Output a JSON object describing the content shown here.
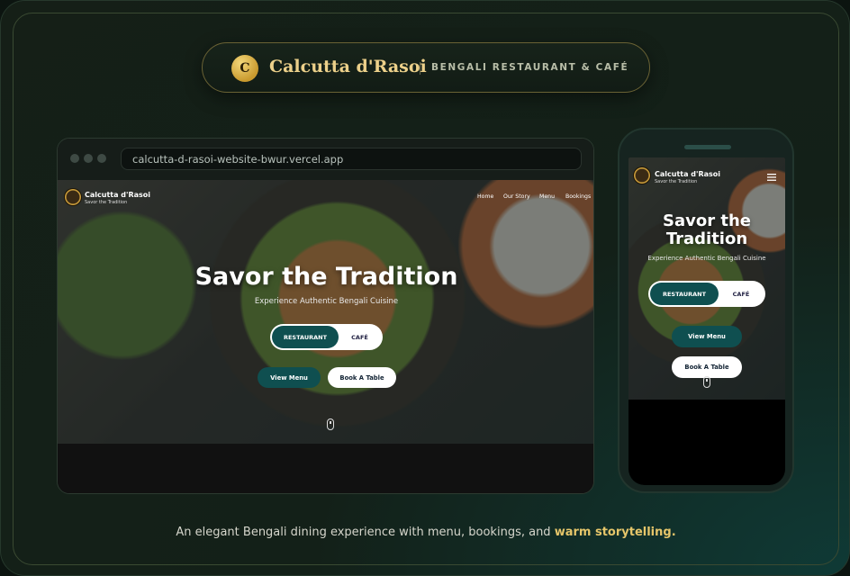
{
  "brand": {
    "logo_letter": "C",
    "name": "Calcutta d'Rasoi",
    "tagline": "BENGALI RESTAURANT & CAFÉ"
  },
  "browser": {
    "url": "calcutta-d-rasoi-website-bwur.vercel.app"
  },
  "site": {
    "title": "Calcutta d'Rasoi",
    "subtitle": "Savor the Tradition",
    "nav": [
      "Home",
      "Our Story",
      "Menu",
      "Bookings"
    ],
    "hero_heading": "Savor the Tradition",
    "hero_subheading": "Experience Authentic Bengali Cuisine",
    "segment": {
      "active": "RESTAURANT",
      "inactive": "CAFÉ"
    },
    "view_menu": "View Menu",
    "book_table": "Book A Table"
  },
  "mobile": {
    "title": "Calcutta d'Rasoi",
    "subtitle": "Savor the Tradition",
    "menu_icon": "hamburger-icon",
    "hero_heading_line1": "Savor the",
    "hero_heading_line2": "Tradition",
    "hero_subheading": "Experience Authentic Bengali Cuisine",
    "segment": {
      "active": "RESTAURANT",
      "inactive": "CAFÉ"
    },
    "view_menu": "View Menu",
    "book_table": "Book A Table"
  },
  "footer": {
    "text": "An elegant Bengali dining experience with menu, bookings, and",
    "highlight": "warm storytelling."
  },
  "colors": {
    "gold": "#ecd08a",
    "teal": "#0f4f50",
    "highlight": "#e6c66a"
  }
}
